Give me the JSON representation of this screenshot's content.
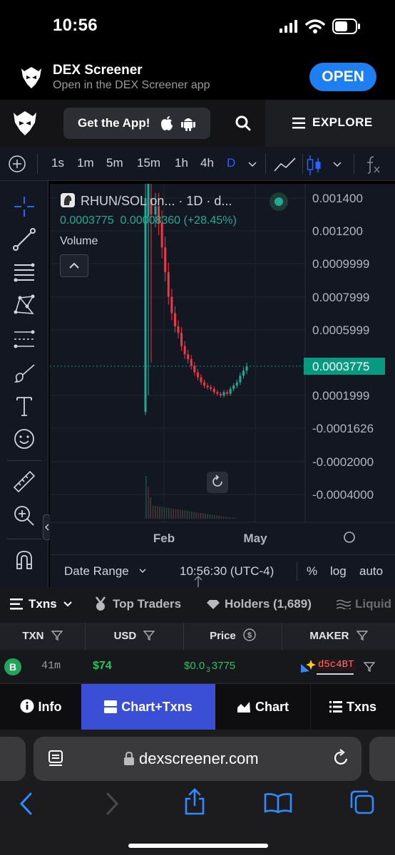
{
  "status": {
    "time": "10:56"
  },
  "banner": {
    "app_name": "DEX Screener",
    "subtitle": "Open in the DEX Screener app",
    "open_label": "OPEN"
  },
  "header": {
    "get_app_label": "Get the App!",
    "explore_label": "EXPLORE"
  },
  "timeframes": [
    "1s",
    "1m",
    "5m",
    "15m",
    "1h",
    "4h",
    "D"
  ],
  "active_timeframe": "D",
  "legend": {
    "pair": "RHUN/SOL on... · 1D · d...",
    "price": "0.0003775",
    "change": "0.00008360 (+28.45%)",
    "volume_label": "Volume"
  },
  "chart_data": {
    "type": "candlestick",
    "price_axis_labels": [
      "0.001400",
      "0.001200",
      "0.0009999",
      "0.0007999",
      "0.0005999",
      "0.0001999",
      "-0.0001626",
      "-0.0002000",
      "-0.0004000"
    ],
    "current_price_label": "0.0003775",
    "time_labels": [
      "Feb",
      "May"
    ],
    "last_price": 0.0003775,
    "series_close": [
      0.00135,
      0.00125,
      0.0011,
      0.00095,
      0.0008,
      0.0007,
      0.00062,
      0.00058,
      0.0005,
      0.00045,
      0.00042,
      0.00038,
      0.00034,
      0.00031,
      0.00028,
      0.00026,
      0.00025,
      0.00024,
      0.00022,
      0.00021,
      0.0002,
      0.00022,
      0.00021,
      0.00024,
      0.00026,
      0.00028,
      0.00032,
      0.00035,
      0.000377
    ],
    "colors": {
      "up": "#22ab94",
      "down": "#f23645",
      "price_tag": "#089981"
    }
  },
  "chart_footer": {
    "date_range": "Date Range",
    "time": "10:56:30 (UTC-4)",
    "percent": "%",
    "log": "log",
    "auto": "auto"
  },
  "tabs": {
    "txns": "Txns",
    "top_traders": "Top Traders",
    "holders": "Holders (1,689)",
    "liquidity": "Liquid"
  },
  "table": {
    "headers": [
      "TXN",
      "USD",
      "Price",
      "MAKER"
    ],
    "row": {
      "type": "B",
      "age": "41m",
      "usd": "$74",
      "price_main": "$0.0",
      "price_sub": "3",
      "price_tail": "3775",
      "maker": "d5c4BT"
    }
  },
  "view_nav": {
    "info": "Info",
    "chart_txns": "Chart+Txns",
    "chart": "Chart",
    "txns": "Txns"
  },
  "safari": {
    "url": "dexscreener.com"
  }
}
